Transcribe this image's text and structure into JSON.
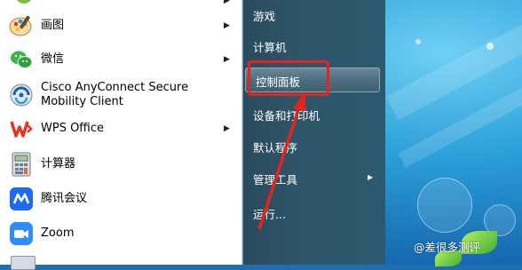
{
  "programs": [
    {
      "label": "画图",
      "icon": "paint-icon",
      "has_submenu": true
    },
    {
      "label": "微信",
      "icon": "wechat-icon",
      "has_submenu": true
    },
    {
      "label": "Cisco AnyConnect Secure",
      "label2": "Mobility Client",
      "icon": "cisco-anyconnect-icon",
      "has_submenu": false
    },
    {
      "label": "WPS Office",
      "icon": "wps-office-icon",
      "has_submenu": true
    },
    {
      "label": "计算器",
      "icon": "calculator-icon",
      "has_submenu": false
    },
    {
      "label": "腾讯会议",
      "icon": "tencent-meeting-icon",
      "has_submenu": false
    },
    {
      "label": "Zoom",
      "icon": "zoom-icon",
      "has_submenu": false
    }
  ],
  "right_panel": [
    {
      "label": "游戏",
      "has_submenu": false
    },
    {
      "label": "计算机",
      "has_submenu": false
    },
    {
      "label": "控制面板",
      "has_submenu": false,
      "highlighted": true
    },
    {
      "label": "设备和打印机",
      "has_submenu": false
    },
    {
      "label": "默认程序",
      "has_submenu": false
    },
    {
      "label": "管理工具",
      "has_submenu": true
    },
    {
      "label": "运行...",
      "has_submenu": false
    }
  ],
  "submenu_arrow": "▶",
  "watermark": "@差很多测评",
  "colors": {
    "annotation_red": "#e8231e",
    "panel_dark": "#2e5568",
    "desktop_blue": "#1e6fb0"
  }
}
